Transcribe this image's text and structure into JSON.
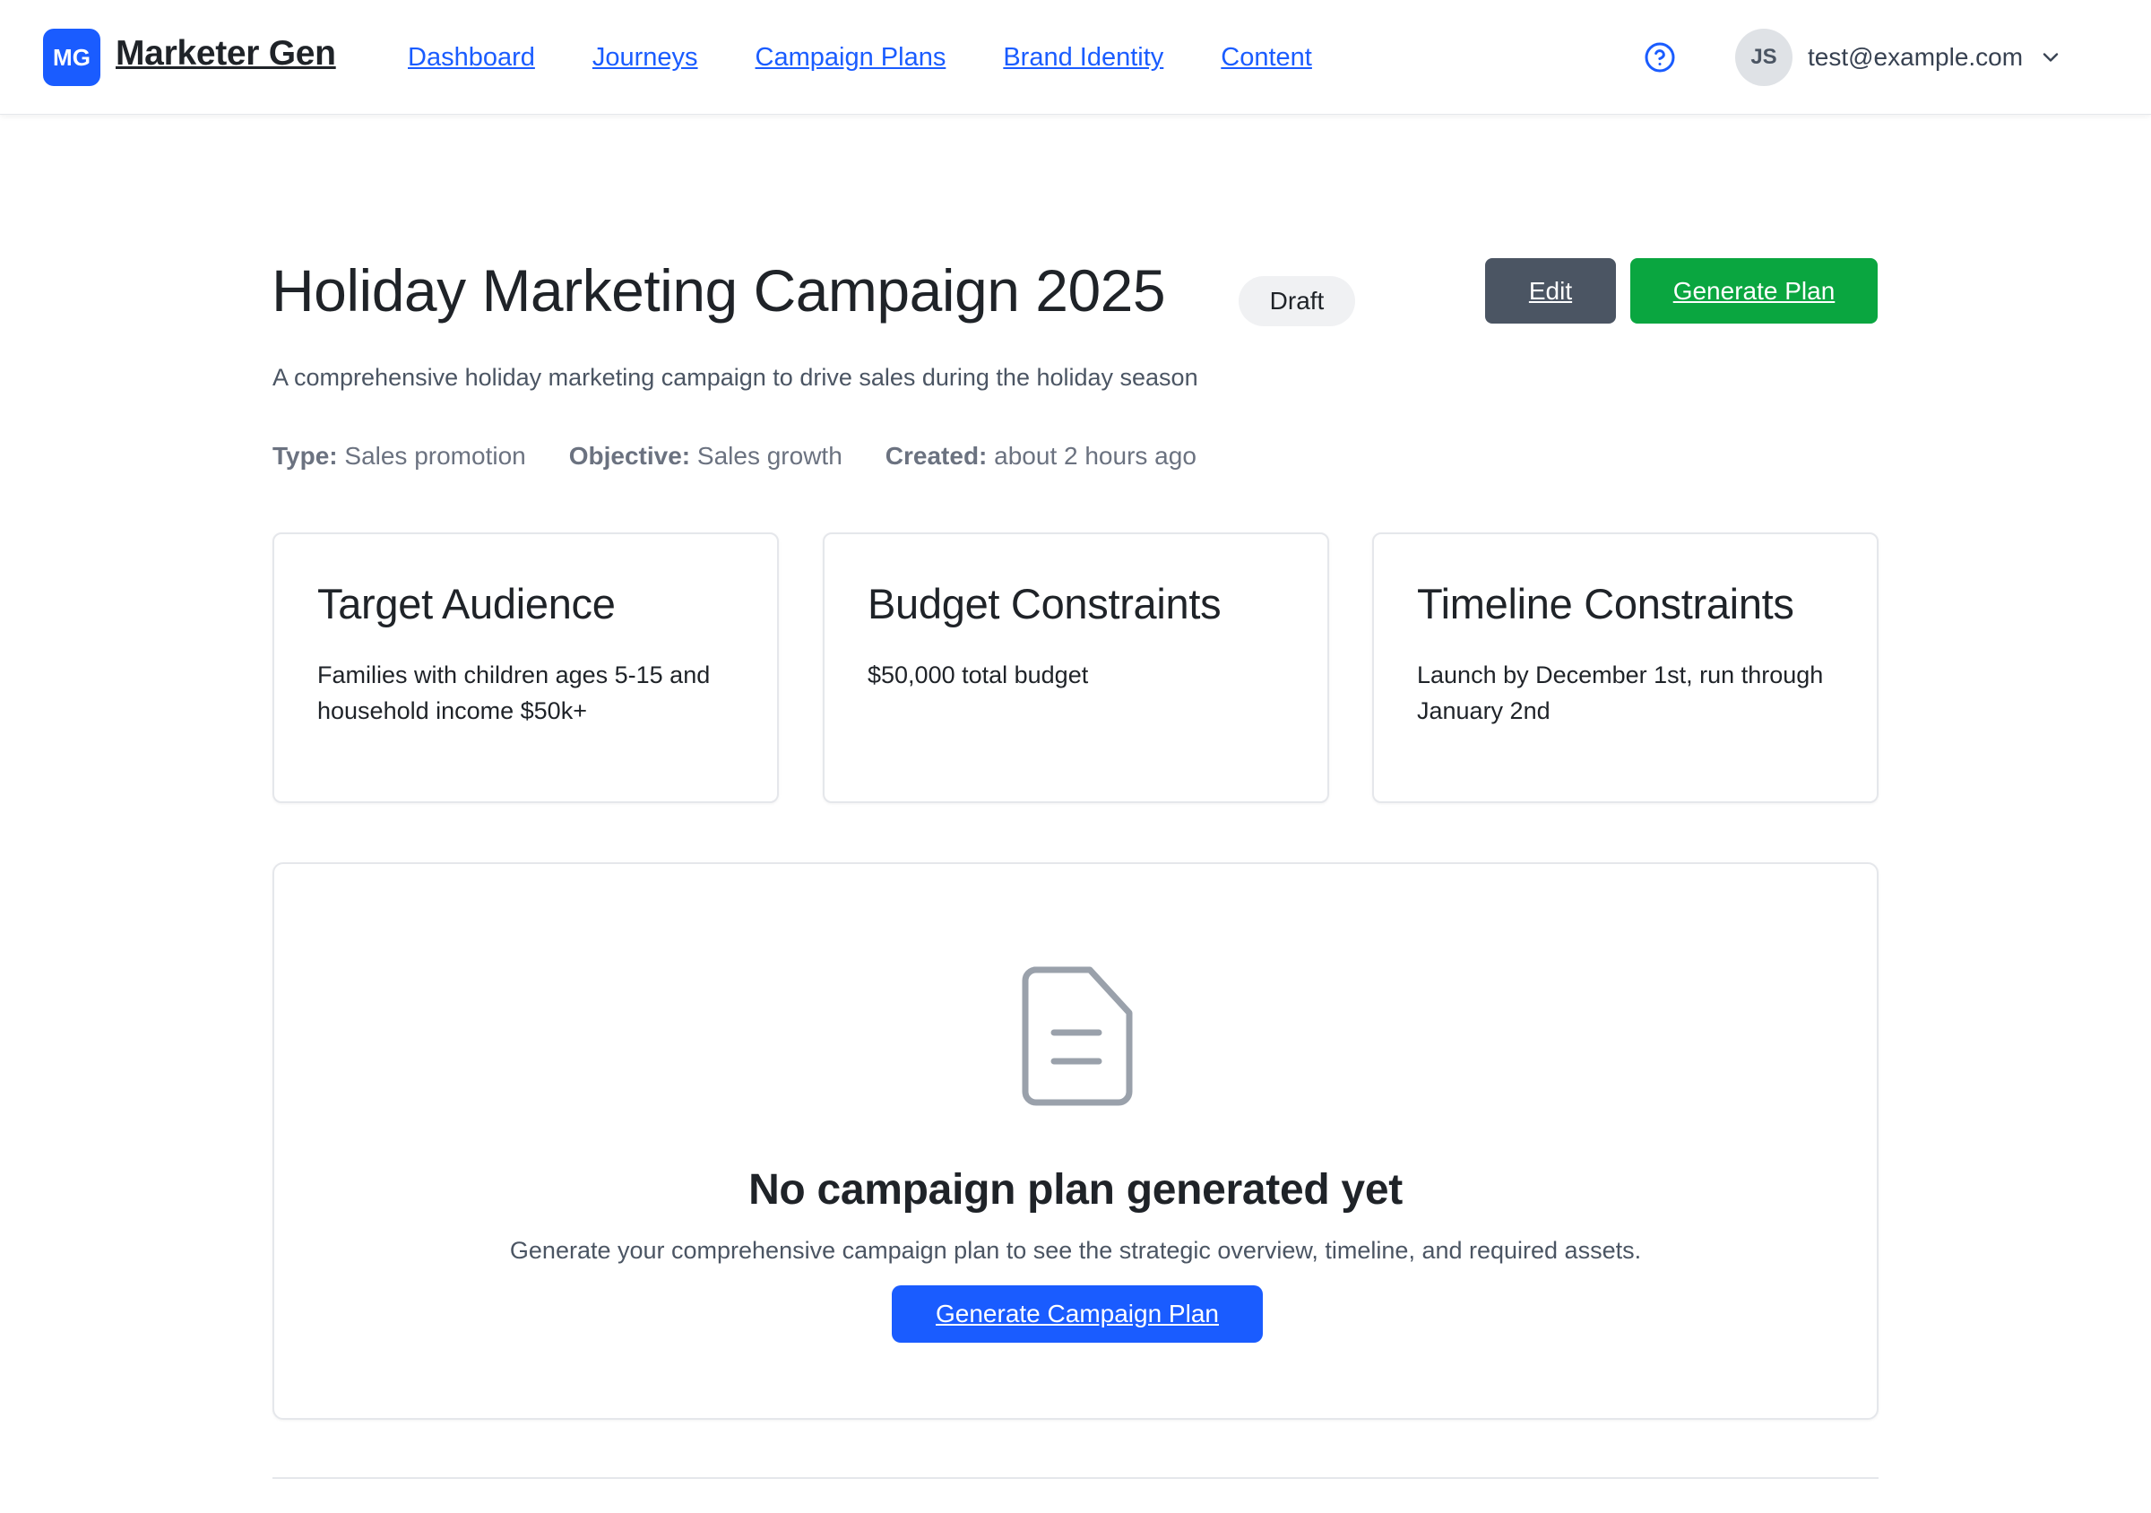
{
  "header": {
    "logo_initials": "MG",
    "brand": "Marketer Gen",
    "nav": [
      {
        "label": "Dashboard"
      },
      {
        "label": "Journeys"
      },
      {
        "label": "Campaign Plans"
      },
      {
        "label": "Brand Identity"
      },
      {
        "label": "Content"
      }
    ],
    "user": {
      "initials": "JS",
      "email": "test@example.com"
    },
    "icons": {
      "help": "question-circle-icon",
      "menu": "chevron-down-icon"
    }
  },
  "campaign": {
    "title": "Holiday Marketing Campaign 2025",
    "status": "Draft",
    "description": "A comprehensive holiday marketing campaign to drive sales during the holiday season",
    "meta": {
      "type_label": "Type:",
      "type_value": "Sales promotion",
      "objective_label": "Objective:",
      "objective_value": "Sales growth",
      "created_label": "Created:",
      "created_value": "about 2 hours ago"
    },
    "actions": {
      "edit": "Edit",
      "generate": "Generate Plan"
    }
  },
  "cards": [
    {
      "title": "Target Audience",
      "text": "Families with children ages 5-15 and household income $50k+"
    },
    {
      "title": "Budget Constraints",
      "text": "$50,000 total budget"
    },
    {
      "title": "Timeline Constraints",
      "text": "Launch by December 1st, run through January 2nd"
    }
  ],
  "empty_state": {
    "icon": "document-icon",
    "title": "No campaign plan generated yet",
    "text": "Generate your comprehensive campaign plan to see the strategic overview, timeline, and required assets.",
    "button": "Generate Campaign Plan"
  },
  "colors": {
    "primary": "#1a5cff",
    "success": "#0aa640",
    "secondary": "#4b5563",
    "badge_bg": "#f0f1f3"
  }
}
